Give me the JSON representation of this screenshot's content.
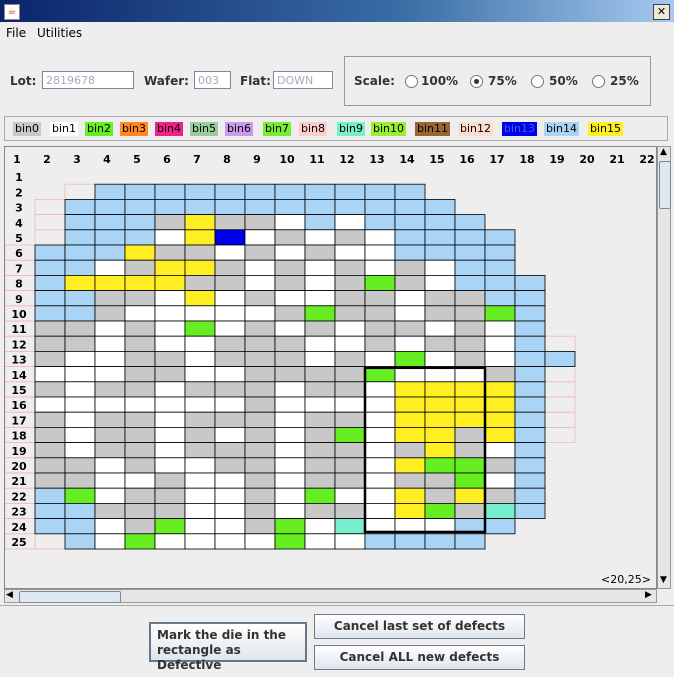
{
  "window": {
    "title": "",
    "close_symbol": "✕"
  },
  "menu": {
    "items": [
      "File",
      "Utilities"
    ]
  },
  "lot": {
    "label": "Lot:",
    "value": "2819678"
  },
  "wafer": {
    "label": "Wafer:",
    "value": "003"
  },
  "flat": {
    "label": "Flat:",
    "value": "DOWN"
  },
  "scale": {
    "label": "Scale:",
    "options": [
      "100%",
      "75%",
      "50%",
      "25%"
    ],
    "selected": "75%"
  },
  "bins": [
    {
      "label": "bin0",
      "color": "#c8c8c8",
      "text_color": "#000000"
    },
    {
      "label": "bin1",
      "color": "#ffffff",
      "text_color": "#000000"
    },
    {
      "label": "bin2",
      "color": "#66ee22",
      "text_color": "#000000"
    },
    {
      "label": "bin3",
      "color": "#ff8822",
      "text_color": "#000000"
    },
    {
      "label": "bin4",
      "color": "#ee2288",
      "text_color": "#000000"
    },
    {
      "label": "bin5",
      "color": "#99cc99",
      "text_color": "#000000"
    },
    {
      "label": "bin6",
      "color": "#cc99ee",
      "text_color": "#000000"
    },
    {
      "label": "bin7",
      "color": "#77ee33",
      "text_color": "#000000"
    },
    {
      "label": "bin8",
      "color": "#ffcccc",
      "text_color": "#000000"
    },
    {
      "label": "bin9",
      "color": "#77eecc",
      "text_color": "#000000"
    },
    {
      "label": "bin10",
      "color": "#99ee33",
      "text_color": "#000000"
    },
    {
      "label": "bin11",
      "color": "#996633",
      "text_color": "#000000"
    },
    {
      "label": "bin12",
      "color": "#ffddcc",
      "text_color": "#000000"
    },
    {
      "label": "bin13",
      "color": "#0000ee",
      "text_color": "#3366cc"
    },
    {
      "label": "bin14",
      "color": "#aad4f5",
      "text_color": "#000000"
    },
    {
      "label": "bin15",
      "color": "#ffee22",
      "text_color": "#000000"
    }
  ],
  "grid": {
    "column_labels": [
      "1",
      "2",
      "3",
      "4",
      "5",
      "6",
      "7",
      "8",
      "9",
      "10",
      "11",
      "12",
      "13",
      "14",
      "15",
      "16",
      "17",
      "18",
      "19",
      "20",
      "21",
      "22"
    ],
    "row_labels": [
      "1",
      "2",
      "3",
      "4",
      "5",
      "6",
      "7",
      "8",
      "9",
      "10",
      "11",
      "12",
      "13",
      "14",
      "15",
      "16",
      "17",
      "18",
      "19",
      "20",
      "21",
      "22",
      "23",
      "24",
      "25"
    ],
    "position_readout": "<20,25>"
  },
  "buttons": {
    "mark_defective": "Mark the die in the rectangle as Defective",
    "cancel_last": "Cancel last set of defects",
    "cancel_all": "Cancel ALL new defects"
  }
}
